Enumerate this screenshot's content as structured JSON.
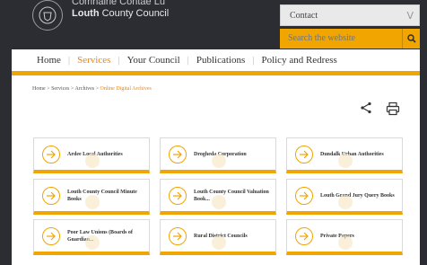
{
  "header": {
    "brand_line1": "Comhairle Contae Lú",
    "brand_line2_bold": "Louth",
    "brand_line2_rest": " County Council",
    "contact_label": "Contact",
    "contact_chevron": "V",
    "search_placeholder": "Search the website"
  },
  "nav": {
    "items": [
      {
        "label": "Home"
      },
      {
        "label": "Services"
      },
      {
        "label": "Your Council"
      },
      {
        "label": "Publications"
      },
      {
        "label": "Policy and Redress"
      }
    ]
  },
  "breadcrumb": {
    "items": [
      "Home",
      "Services",
      "Archives"
    ],
    "separator": ">",
    "current": "Online Digital Archives"
  },
  "cards": [
    {
      "label": "Ardee Local Authorities"
    },
    {
      "label": "Drogheda Corporation"
    },
    {
      "label": "Dundalk Urban Authorities"
    },
    {
      "label": "Louth County Council Minute Books"
    },
    {
      "label": "Louth County Council Valuation Book..."
    },
    {
      "label": "Louth Grand Jury Query Books"
    },
    {
      "label": "Poor Law Unions (Boards of Guardian..."
    },
    {
      "label": "Rural District Councils"
    },
    {
      "label": "Private Papers"
    }
  ],
  "icons": {
    "share": "share-icon",
    "print": "print-icon",
    "arrow": "arrow-right-circle-icon",
    "search": "search-icon"
  },
  "colors": {
    "accent": "#f0a500",
    "active_nav": "#e8861b",
    "header_bg": "#2b2d33"
  }
}
